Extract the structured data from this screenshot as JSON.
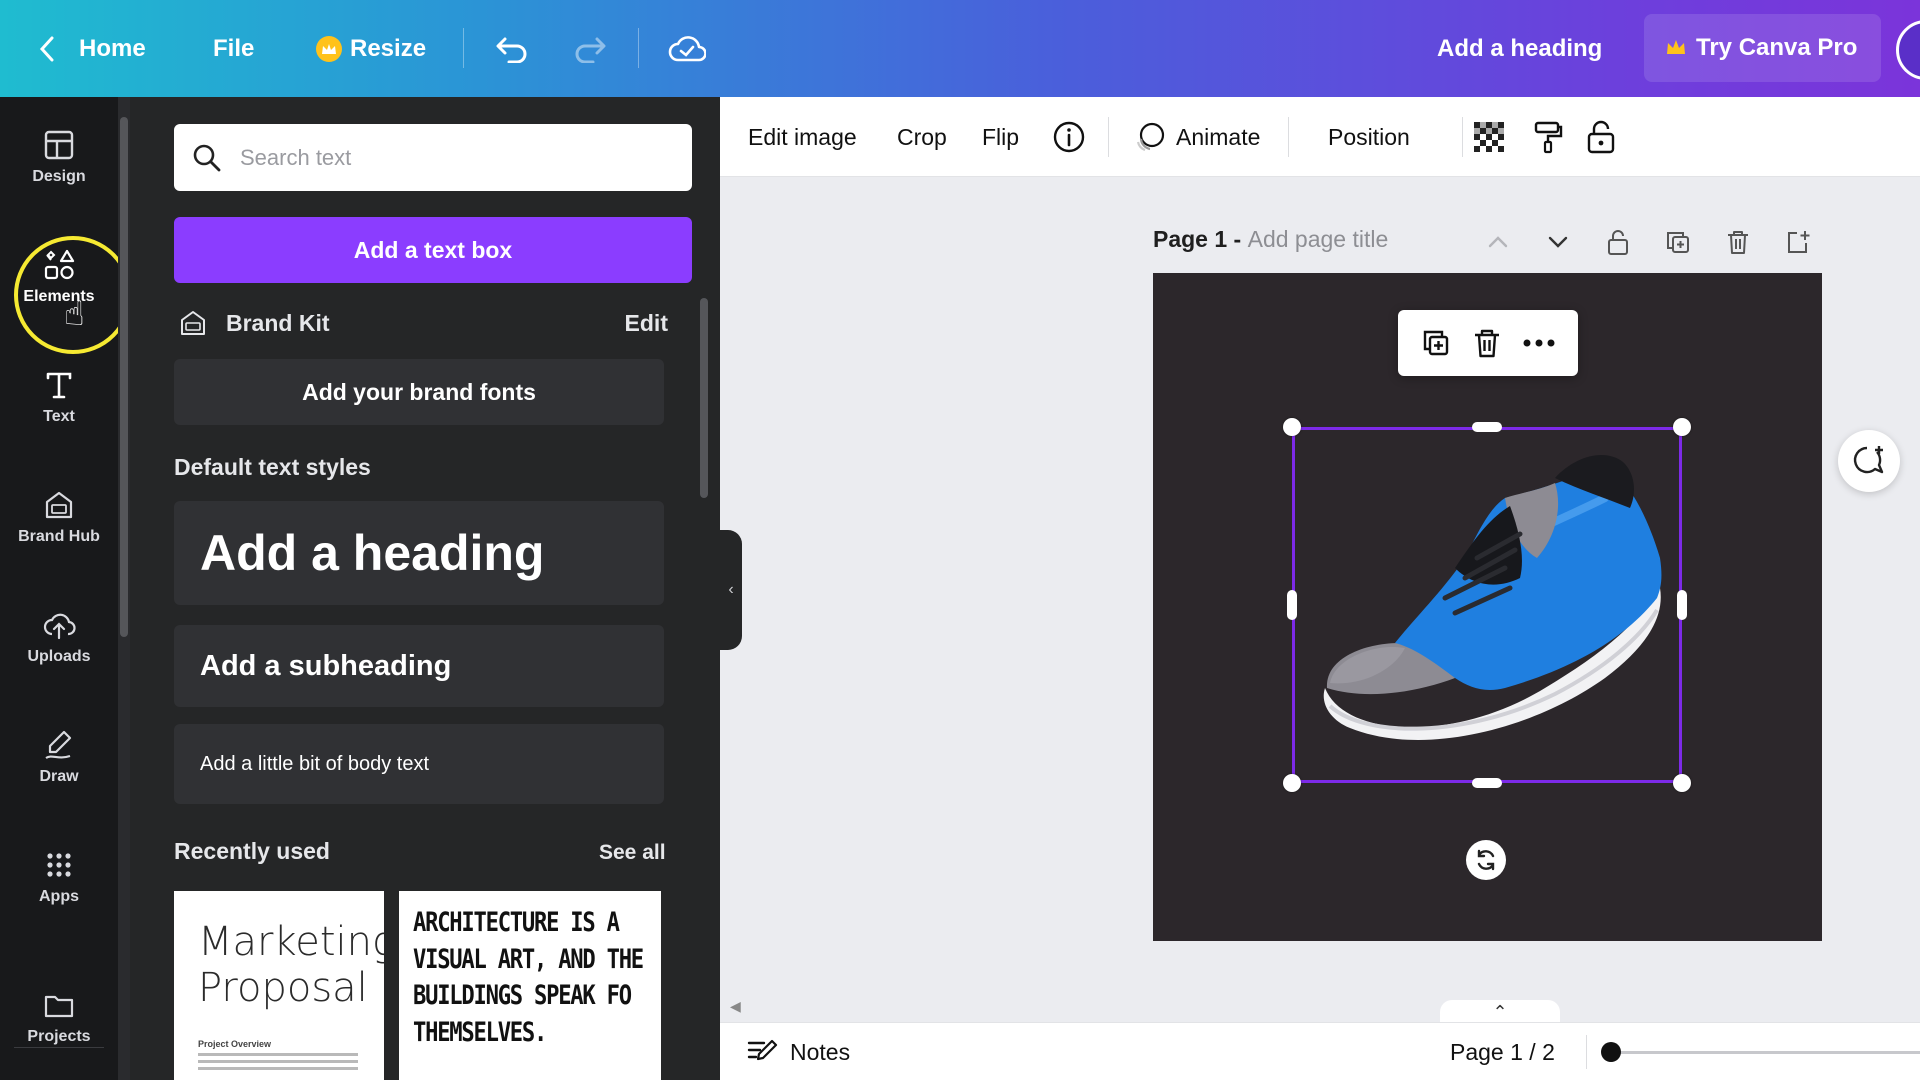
{
  "topbar": {
    "home_label": "Home",
    "file_label": "File",
    "resize_label": "Resize",
    "doc_title": "Add a heading",
    "try_pro_label": "Try Canva Pro",
    "icons": [
      "chevron-left-icon",
      "crown-icon",
      "undo-icon",
      "redo-icon",
      "cloud-check-icon"
    ]
  },
  "leftnav": {
    "items": [
      {
        "label": "Design",
        "icon": "design-layout-icon"
      },
      {
        "label": "Elements",
        "icon": "elements-shapes-icon",
        "active": true
      },
      {
        "label": "Text",
        "icon": "text-t-icon"
      },
      {
        "label": "Brand Hub",
        "icon": "brand-hub-icon"
      },
      {
        "label": "Uploads",
        "icon": "upload-cloud-icon"
      },
      {
        "label": "Draw",
        "icon": "draw-pen-icon"
      },
      {
        "label": "Apps",
        "icon": "apps-grid-icon"
      },
      {
        "label": "Projects",
        "icon": "folder-icon"
      }
    ]
  },
  "panel": {
    "search_placeholder": "Search text",
    "add_textbox_label": "Add a text box",
    "brand_kit_label": "Brand Kit",
    "brand_kit_edit": "Edit",
    "brand_fonts_label": "Add your brand fonts",
    "default_styles_title": "Default text styles",
    "heading_label": "Add a heading",
    "subheading_label": "Add a subheading",
    "body_label": "Add a little bit of body text",
    "recently_used_title": "Recently used",
    "see_all_label": "See all",
    "recent": [
      {
        "title_line1": "Marketing",
        "title_line2": "Proposal",
        "subtitle": "Project Overview"
      },
      {
        "line1": "ARCHITECTURE IS A",
        "line2": "VISUAL ART, AND THE",
        "line3": "BUILDINGS SPEAK FO",
        "line4": "THEMSELVES."
      }
    ]
  },
  "context_toolbar": {
    "edit_image": "Edit image",
    "crop": "Crop",
    "flip": "Flip",
    "animate": "Animate",
    "position": "Position",
    "icons": [
      "info-icon",
      "animate-icon",
      "transparency-icon",
      "paint-roller-icon",
      "lock-icon"
    ]
  },
  "page": {
    "label": "Page 1 -",
    "title_placeholder": "Add page title",
    "icons": [
      "chevron-up-icon",
      "chevron-down-icon",
      "lock-icon",
      "duplicate-page-icon",
      "trash-icon",
      "add-page-icon"
    ]
  },
  "canvas": {
    "background": "#2c272b",
    "selection_color": "#7d2ae8",
    "element": "blue-running-shoe",
    "float_menu_icons": [
      "duplicate-icon",
      "trash-icon",
      "more-dots-icon"
    ]
  },
  "bottombar": {
    "notes_label": "Notes",
    "page_count": "Page 1 / 2"
  },
  "colors": {
    "accent": "#8b3dff",
    "panel_bg": "#252627",
    "nav_bg": "#18191b",
    "highlight": "#f6ea32"
  }
}
